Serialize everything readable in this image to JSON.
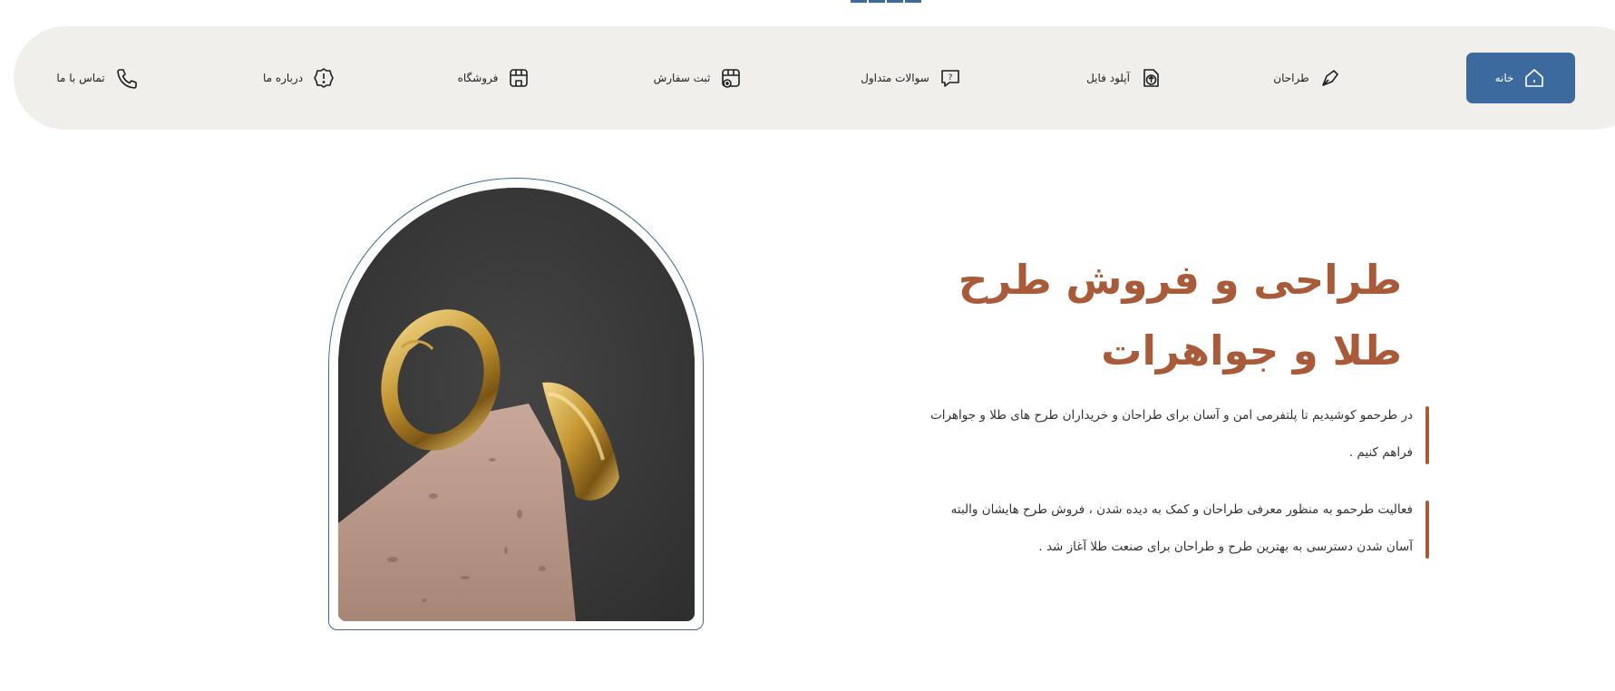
{
  "nav": {
    "items": [
      {
        "label": "خانه",
        "icon": "home-icon",
        "active": true
      },
      {
        "label": "طراحان",
        "icon": "pen-tool-icon"
      },
      {
        "label": "آپلود فایل",
        "icon": "upload-icon"
      },
      {
        "label": "سوالات متداول",
        "icon": "question-chat-icon"
      },
      {
        "label": "ثبت سفارش",
        "icon": "order-add-icon"
      },
      {
        "label": "فروشگاه",
        "icon": "shop-icon"
      },
      {
        "label": "درباره ما",
        "icon": "info-badge-icon"
      },
      {
        "label": "تماس با ما",
        "icon": "phone-icon"
      }
    ]
  },
  "hero": {
    "title_line1": "طراحی و فروش طرح",
    "title_line2": "طلا و جواهرات",
    "paragraph1": "در طرحمو کوشیدیم تا پلتفرمی امن و آسان برای طراحان و خریداران طرح های طلا و جواهرات فراهم کنیم .",
    "paragraph2": "فعالیت طرحمو به منظور معرفی طراحان و کمک به دیده شدن ، فروش طرح هایشان والبته آسان شدن دسترسی به بهترین طرح و طراحان برای صنعت طلا آغاز شد ."
  },
  "image": {
    "subject": "gold hoop earrings on stone"
  },
  "colors": {
    "accent": "#3c6a9f",
    "brown": "#a95a38",
    "nav_bg": "#f0efec"
  }
}
